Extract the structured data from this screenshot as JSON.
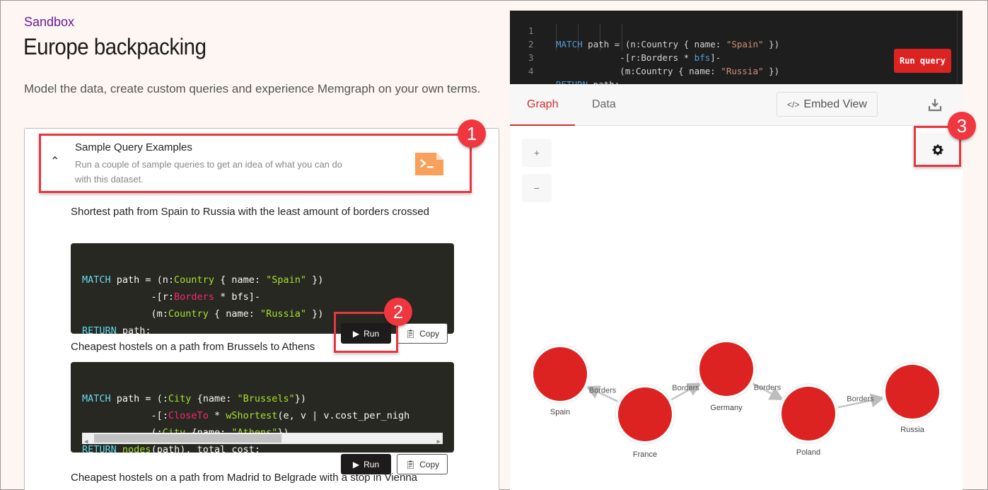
{
  "header": {
    "breadcrumb": "Sandbox",
    "title": "Europe backpacking",
    "description": "Model the data, create custom queries and experience Memgraph on your own terms."
  },
  "accordion": {
    "title": "Sample Query Examples",
    "subtitle": "Run a couple of sample queries to get an idea of what you can do with this dataset.",
    "icon": "terminal-file-icon",
    "accent": "#f9a05a"
  },
  "queries": [
    {
      "description": "Shortest path from Spain to Russia with the least amount of borders crossed",
      "run_label": "Run",
      "copy_label": "Copy"
    },
    {
      "description": "Cheapest hostels on a path from Brussels to Athens",
      "run_label": "Run",
      "copy_label": "Copy"
    },
    {
      "description": "Cheapest hostels on a path from Madrid to Belgrade with a stop in Vienna"
    }
  ],
  "code1": {
    "l1": [
      "MATCH",
      " path = (n:",
      "Country",
      " { name: ",
      "\"Spain\"",
      " })"
    ],
    "l2": [
      "            -[r:",
      "Borders",
      " * bfs]-"
    ],
    "l3": [
      "            (m:",
      "Country",
      " { name: ",
      "\"Russia\"",
      " })"
    ],
    "l4": [
      "RETURN",
      " path;"
    ]
  },
  "code2": {
    "l1": [
      "MATCH",
      " path = (:",
      "City",
      " {name: ",
      "\"Brussels\"",
      "})"
    ],
    "l2": [
      "            -[:",
      "CloseTo",
      " * ",
      "wShortest",
      "(e, v | v.cost_per_nigh"
    ],
    "l3": [
      "            (:",
      "City",
      " {name: ",
      "\"Athens\"",
      "})"
    ],
    "l4": [
      "RETURN",
      " ",
      "nodes",
      "(path), total_cost;"
    ]
  },
  "editor": {
    "lines": [
      {
        "num": "1",
        "parts": [
          "MATCH",
          " path = (n:Country { name: ",
          "\"Spain\"",
          " })"
        ]
      },
      {
        "num": "2",
        "parts": [
          "",
          "            -[r:Borders * ",
          "bfs",
          "]-"
        ]
      },
      {
        "num": "3",
        "parts": [
          "",
          "            (m:Country { name: ",
          "\"Russia\"",
          " })"
        ]
      },
      {
        "num": "4",
        "parts": [
          "RETURN",
          " path;",
          "",
          ""
        ]
      }
    ],
    "run_label": "Run query",
    "run_color": "#dc2322"
  },
  "result_tabs": [
    {
      "label": "Graph",
      "active": true
    },
    {
      "label": "Data",
      "active": false
    }
  ],
  "embed_label": "Embed View",
  "zoom_in": "+",
  "zoom_out": "−",
  "annotations": [
    "1",
    "2",
    "3"
  ],
  "graph": {
    "node_color": "#dc2322",
    "nodes": [
      {
        "id": "spain",
        "label": "Spain"
      },
      {
        "id": "france",
        "label": "France"
      },
      {
        "id": "germany",
        "label": "Germany"
      },
      {
        "id": "poland",
        "label": "Poland"
      },
      {
        "id": "russia",
        "label": "Russia"
      }
    ],
    "edges": [
      {
        "from": "france",
        "to": "spain",
        "label": "Borders"
      },
      {
        "from": "france",
        "to": "germany",
        "label": "Borders"
      },
      {
        "from": "germany",
        "to": "poland",
        "label": "Borders"
      },
      {
        "from": "poland",
        "to": "russia",
        "label": "Borders"
      }
    ]
  }
}
